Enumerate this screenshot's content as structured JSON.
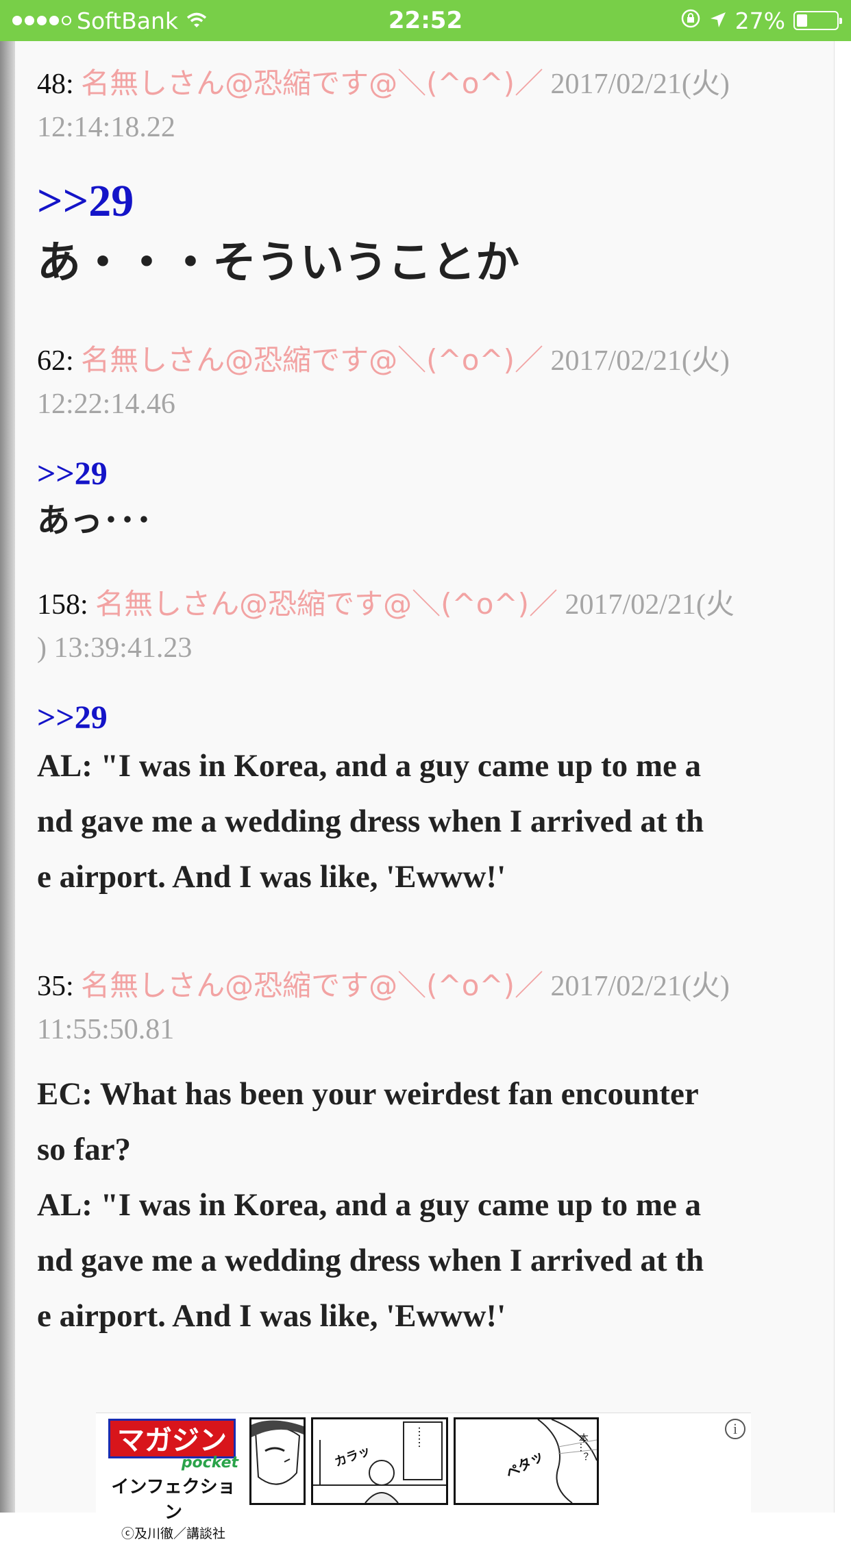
{
  "status_bar": {
    "carrier": "SoftBank",
    "time": "22:52",
    "battery": "27%",
    "battery_level": 0.27,
    "icons": [
      "signal-dots-icon",
      "wifi-icon",
      "orientation-lock-icon",
      "location-arrow-icon",
      "battery-icon"
    ]
  },
  "posts": [
    {
      "number": "48:",
      "name": "名無しさん@恐縮です@＼(^o^)／",
      "date_line1": "2017/02/21(火)",
      "date_line2": "12:14:18.22",
      "anchor": ">>29",
      "body": "あ・・・そういうことか"
    },
    {
      "number": "62:",
      "name": "名無しさん@恐縮です@＼(^o^)／",
      "date_line1": "2017/02/21(火)",
      "date_line2": "12:22:14.46",
      "anchor": ">>29",
      "body": "あっ･･･"
    },
    {
      "number": "158:",
      "name": "名無しさん@恐縮です@＼(^o^)／",
      "date_line1": "2017/02/21(火",
      "date_line2": ") 13:39:41.23",
      "anchor": ">>29",
      "body_lines": [
        "AL: \"I was in Korea, and a guy came up to me a",
        "nd gave me a wedding dress when I arrived at th",
        "e airport. And I was like, 'Ewww!'"
      ]
    },
    {
      "number": "35:",
      "name": "名無しさん@恐縮です@＼(^o^)／",
      "date_line1": "2017/02/21(火)",
      "date_line2": "11:55:50.81",
      "body_lines": [
        "EC: What has been your weirdest fan encounter",
        "so far?",
        "AL: \"I was in Korea, and a guy came up to me a",
        "nd gave me a wedding dress when I arrived at th",
        "e airport. And I was like, 'Ewww!'"
      ]
    }
  ],
  "ad": {
    "logo": "マガジン",
    "logo_sub": "pocket",
    "title": "インフェクション",
    "credit": "ⓒ及川徹／講談社",
    "panel_texts": [
      "カラッ",
      "……",
      "ペタッ",
      "本…？"
    ],
    "info_glyph": "i"
  },
  "colors": {
    "status_bar": "#78cf48",
    "anchor": "#1414c8",
    "name": "#f2a3a3",
    "date": "#a5a5a5",
    "body": "#222222",
    "page_bg": "#f9f9f9"
  }
}
